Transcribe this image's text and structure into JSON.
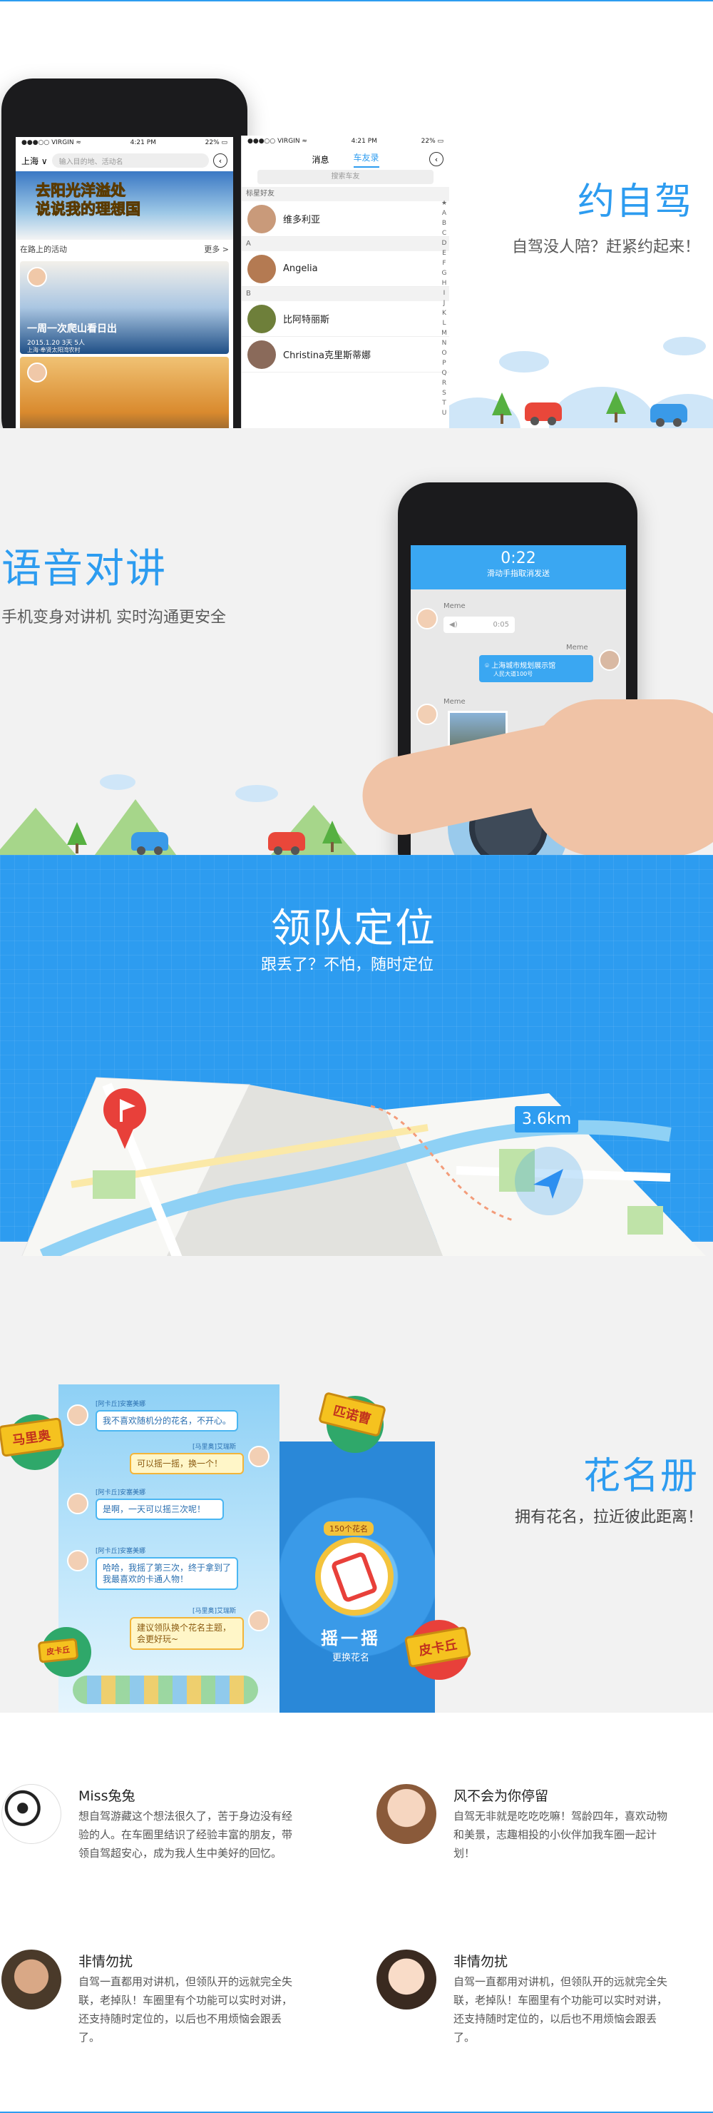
{
  "colors": {
    "accent": "#2d9cf0",
    "map_pin": "#e8403a"
  },
  "sec1": {
    "title": "约自驾",
    "subtitle": "自驾没人陪？赶紧约起来！",
    "phone_left": {
      "status_left": "●●●○○ VIRGIN ≈",
      "status_time": "4:21 PM",
      "status_right": "22% ▭",
      "city": "上海 ∨",
      "search_placeholder": "输入目的地、活动名",
      "back_icon": "back-icon",
      "banner_line1": "去阳光洋溢处",
      "banner_line2": "说说我的理想国",
      "section_label": "在路上的活动",
      "more_label": "更多 >",
      "card1_title": "一周一次爬山看日出",
      "card1_meta": "2015.1.20   3天   5人",
      "card1_loc": "上海·奉贤太阳湾农村"
    },
    "phone_right": {
      "status_left": "●●●○○ VIRGIN ≈",
      "status_time": "4:21 PM",
      "status_right": "22% ▭",
      "tab_messages": "消息",
      "tab_contacts": "车友录",
      "search_placeholder": "搜索车友",
      "group_starred": "标星好友",
      "group_a": "A",
      "group_b": "B",
      "contacts": [
        "维多利亚",
        "Angelia",
        "比阿特丽斯",
        "Christina克里斯蒂娜"
      ],
      "alpha": [
        "★",
        "A",
        "B",
        "C",
        "D",
        "E",
        "F",
        "G",
        "H",
        "I",
        "J",
        "K",
        "L",
        "M",
        "N",
        "O",
        "P",
        "Q",
        "R",
        "S",
        "T",
        "U"
      ]
    }
  },
  "sec2": {
    "title": "语音对讲",
    "subtitle": "手机变身对讲机 实时沟通更安全",
    "timer": "0:22",
    "hint": "滑动手指取消发送",
    "sender_name": "Meme",
    "voice_duration": "0:05",
    "me_name": "Meme",
    "location_title": "上海城市规划展示馆",
    "location_addr": "人民大道100号",
    "sender2_name": "Meme"
  },
  "sec3": {
    "title": "领队定位",
    "subtitle": "跟丢了？不怕，随时定位",
    "distance": "3.6km"
  },
  "sec4": {
    "title": "花名册",
    "subtitle": "拥有花名，拉近彼此距离！",
    "tags": [
      "马里奥",
      "皮卡丘",
      "匹诺曹",
      "皮卡丘"
    ],
    "chat": [
      {
        "name": "[阿卡丘]安塞美娜",
        "text": "我不喜欢随机分的花名，不开心。"
      },
      {
        "name": "[马里奥]艾瑞斯",
        "text": "可以摇一摇，换一个！"
      },
      {
        "name": "[阿卡丘]安塞美娜",
        "text": "是啊，一天可以摇三次呢！"
      },
      {
        "name": "[阿卡丘]安塞美娜",
        "text": "哈哈，我摇了第三次，终于拿到了我最喜欢的卡通人物！"
      },
      {
        "name": "[马里奥]艾瑞斯",
        "text": "建议领队换个花名主题，会更好玩~"
      }
    ],
    "shake_count": "150个花名",
    "shake_label": "摇一摇",
    "shake_sub": "更换花名"
  },
  "reviews": [
    {
      "name": "Miss兔兔",
      "text": "想自驾游藏这个想法很久了，苦于身边没有经验的人。在车圈里结识了经验丰富的朋友，带领自驾超安心，成为我人生中美好的回忆。"
    },
    {
      "name": "风不会为你停留",
      "text": "自驾无非就是吃吃吃嘛！驾龄四年，喜欢动物和美景，志趣相投的小伙伴加我车圈一起计划！"
    },
    {
      "name": "非情勿扰",
      "text": "自驾一直都用对讲机，但领队开的远就完全失联，老掉队！车圈里有个功能可以实时对讲，还支持随时定位的，以后也不用烦恼会跟丢了。"
    },
    {
      "name": "非情勿扰",
      "text": "自驾一直都用对讲机，但领队开的远就完全失联，老掉队！车圈里有个功能可以实时对讲，还支持随时定位的，以后也不用烦恼会跟丢了。"
    }
  ]
}
